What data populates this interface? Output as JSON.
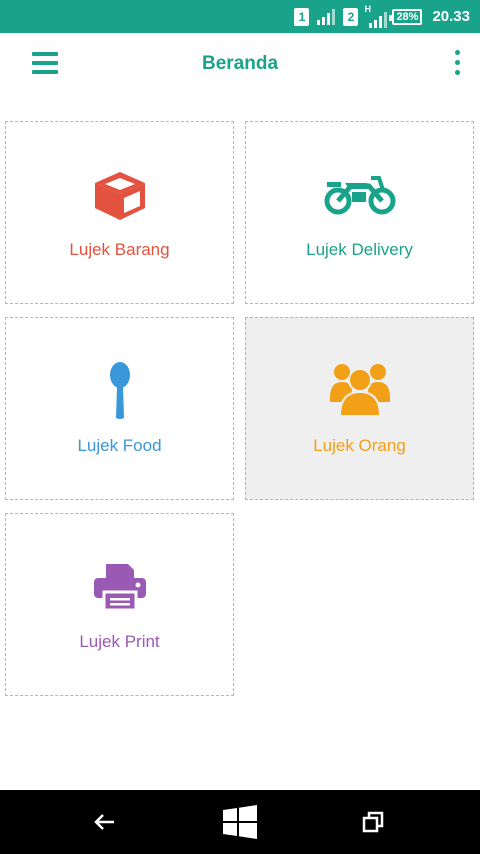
{
  "status": {
    "sim1": "1",
    "sim2": "2",
    "network_type": "H",
    "battery": "28%",
    "time": "20.33"
  },
  "appbar": {
    "title": "Beranda",
    "menu_icon": "hamburger-menu-icon",
    "more_icon": "more-vertical-icon",
    "accent": "#1aa38b"
  },
  "services": [
    {
      "label": "Lujek Barang",
      "icon": "box-icon",
      "color": "#e2523f"
    },
    {
      "label": "Lujek Delivery",
      "icon": "motorcycle-icon",
      "color": "#1aa38b"
    },
    {
      "label": "Lujek Food",
      "icon": "spoon-icon",
      "color": "#3a97d9"
    },
    {
      "label": "Lujek Orang",
      "icon": "people-group-icon",
      "color": "#f2a017"
    },
    {
      "label": "Lujek Print",
      "icon": "printer-icon",
      "color": "#9b59b6"
    }
  ],
  "navbar": {
    "back_icon": "back-arrow-icon",
    "home_icon": "windows-logo-icon",
    "recent_icon": "recent-apps-icon"
  }
}
